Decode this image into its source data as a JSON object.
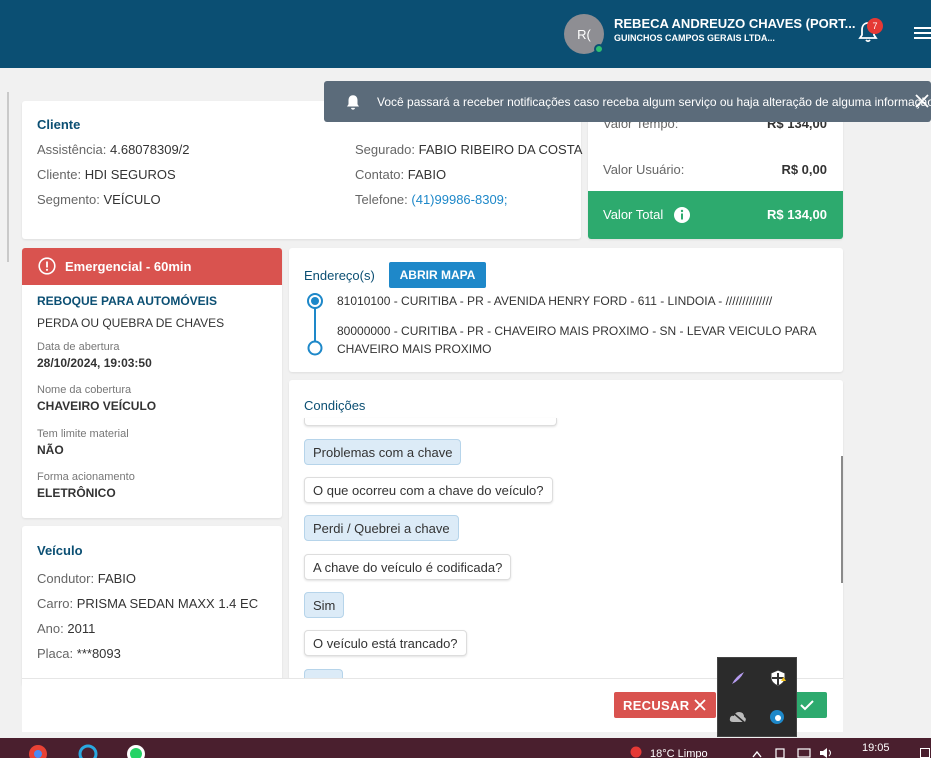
{
  "header": {
    "avatar_initials": "R(",
    "user_name": "REBECA ANDREUZO CHAVES (PORT...",
    "company": "GUINCHOS CAMPOS GERAIS LTDA...",
    "notification_count": "7",
    "bg_color": "#0b4f73"
  },
  "toast": {
    "message": "Você passará a receber notificações caso receba algum serviço ou haja alteração de alguma informação"
  },
  "client": {
    "title": "Cliente",
    "assistencia_label": "Assistência:",
    "assistencia": "4.68078309/2",
    "cliente_label": "Cliente:",
    "cliente": "HDI SEGUROS",
    "segmento_label": "Segmento:",
    "segmento": "VEÍCULO",
    "segurado_label": "Segurado:",
    "segurado": "FABIO RIBEIRO DA COSTA",
    "contato_label": "Contato:",
    "contato": "FABIO",
    "telefone_label": "Telefone:",
    "telefone": "(41)99986-8309;"
  },
  "values": {
    "tempo_label": "Valor Tempo:",
    "tempo": "R$ 134,00",
    "usuario_label": "Valor Usuário:",
    "usuario": "R$ 0,00",
    "total_label": "Valor Total",
    "total": "R$ 134,00"
  },
  "service": {
    "badge": "Emergencial - 60min",
    "type": "REBOQUE PARA AUTOMÓVEIS",
    "reason": "PERDA OU QUEBRA DE CHAVES",
    "abertura_label": "Data de abertura",
    "abertura": "28/10/2024, 19:03:50",
    "cobertura_label": "Nome da cobertura",
    "cobertura": "CHAVEIRO VEÍCULO",
    "limite_label": "Tem limite material",
    "limite": "NÃO",
    "acionamento_label": "Forma acionamento",
    "acionamento": "ELETRÔNICO"
  },
  "vehicle": {
    "title": "Veículo",
    "condutor_label": "Condutor:",
    "condutor": "FABIO",
    "carro_label": "Carro:",
    "carro": "PRISMA SEDAN MAXX 1.4 EC",
    "ano_label": "Ano:",
    "ano": "2011",
    "placa_label": "Placa:",
    "placa": "***8093"
  },
  "addresses": {
    "title": "Endereço(s)",
    "map_button": "ABRIR MAPA",
    "origin": "81010100 - CURITIBA - PR - AVENIDA HENRY FORD - 611 - LINDOIA - //////////////",
    "destination": "80000000 - CURITIBA - PR - CHAVEIRO MAIS PROXIMO - SN - LEVAR VEICULO PARA CHAVEIRO MAIS PROXIMO"
  },
  "conditions": {
    "title": "Condições",
    "items": [
      {
        "kind": "answer",
        "text": "Problemas com a chave"
      },
      {
        "kind": "question",
        "text": "O que ocorreu com a chave do veículo?"
      },
      {
        "kind": "answer",
        "text": "Perdi / Quebrei a chave"
      },
      {
        "kind": "question",
        "text": "A chave do veículo é codificada?"
      },
      {
        "kind": "answer",
        "text": "Sim"
      },
      {
        "kind": "question",
        "text": "O veículo está trancado?"
      }
    ]
  },
  "actions": {
    "reject": "RECUSAR"
  },
  "taskbar": {
    "weather": "18°C  Limpo",
    "time": "19:05"
  }
}
